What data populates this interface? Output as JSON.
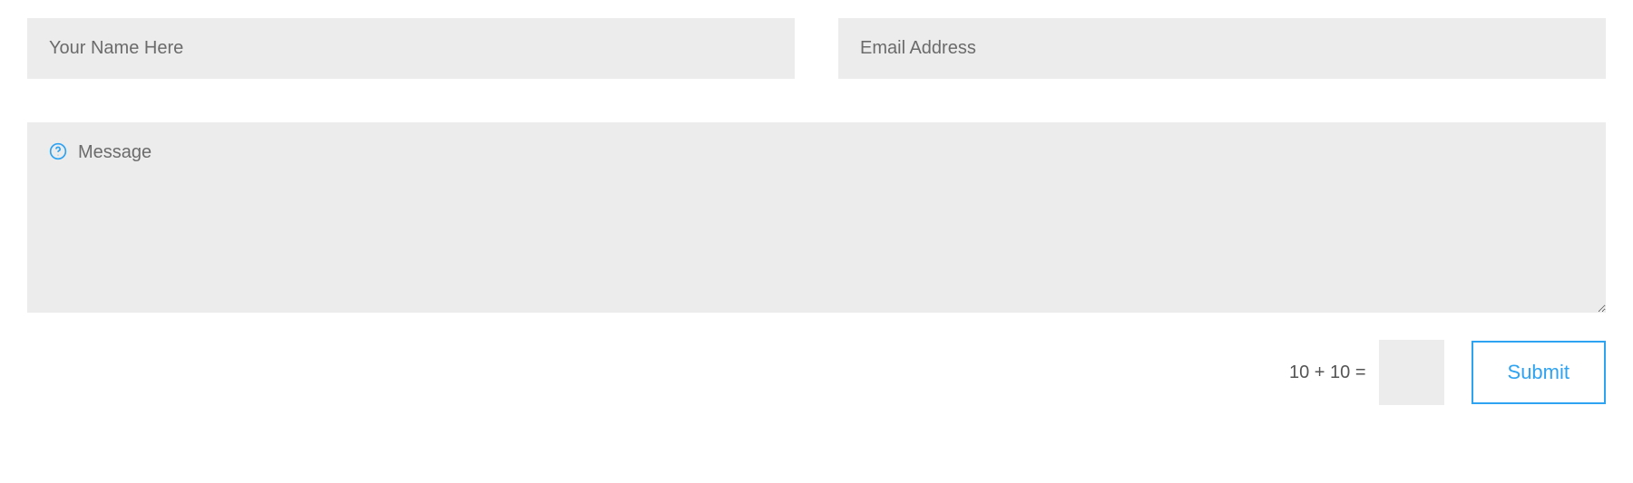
{
  "form": {
    "name": {
      "placeholder": "Your Name Here",
      "value": ""
    },
    "email": {
      "placeholder": "Email Address",
      "value": ""
    },
    "message": {
      "placeholder": "Message",
      "value": ""
    },
    "captcha": {
      "question": "10 + 10 =",
      "value": ""
    },
    "submit_label": "Submit"
  },
  "colors": {
    "field_bg": "#ececec",
    "placeholder": "#6b6b6b",
    "accent": "#2ea3f2"
  }
}
